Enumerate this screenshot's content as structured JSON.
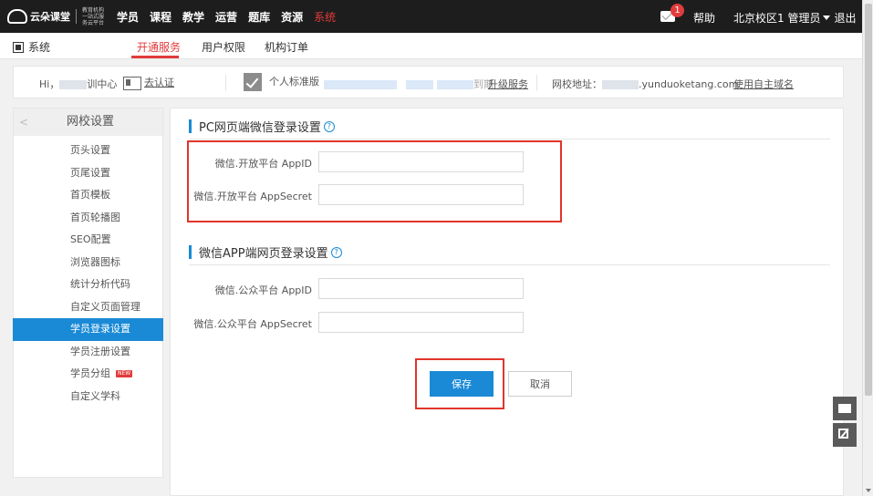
{
  "topbar": {
    "logo_brand": "云朵课堂",
    "logo_slogan": "教育机构一站式服务云平台",
    "nav": [
      "学员",
      "课程",
      "教学",
      "运营",
      "题库",
      "资源",
      "系统"
    ],
    "active_nav": "系统",
    "notification_count": "1",
    "help": "帮助",
    "campus": "北京校区1",
    "role": "管理员",
    "logout": "退出"
  },
  "subnav": {
    "system": "系统",
    "tabs": [
      "开通服务",
      "用户权限",
      "机构订单"
    ],
    "active_tab": "开通服务"
  },
  "infobar": {
    "greeting": "Hi，",
    "org_suffix": "训中心",
    "verify": "去认证",
    "plan": "个人标准版",
    "expiry_suffix": "到期",
    "upgrade": "升级服务",
    "school_url_label": "网校地址：",
    "school_url_suffix": ".yunduoketang.com",
    "custom_domain": "使用自主域名"
  },
  "sidebar": {
    "title": "网校设置",
    "items": [
      "页头设置",
      "页尾设置",
      "首页模板",
      "首页轮播图",
      "SEO配置",
      "浏览器图标",
      "统计分析代码",
      "自定义页面管理",
      "学员登录设置",
      "学员注册设置",
      "学员分组",
      "自定义学科"
    ],
    "active": "学员登录设置",
    "new_tag": "NEW"
  },
  "main": {
    "pc_section": {
      "title": "PC网页端微信登录设置",
      "fields": [
        {
          "label": "微信.开放平台 AppID",
          "value": ""
        },
        {
          "label": "微信.开放平台 AppSecret",
          "value": ""
        }
      ]
    },
    "app_section": {
      "title": "微信APP端网页登录设置",
      "fields": [
        {
          "label": "微信.公众平台 AppID",
          "value": ""
        },
        {
          "label": "微信.公众平台 AppSecret",
          "value": ""
        }
      ]
    },
    "save": "保存",
    "cancel": "取消"
  },
  "colors": {
    "accent_blue": "#1a8ad6",
    "highlight_red": "#e0352b",
    "topbar_bg": "#1d1d1d"
  }
}
